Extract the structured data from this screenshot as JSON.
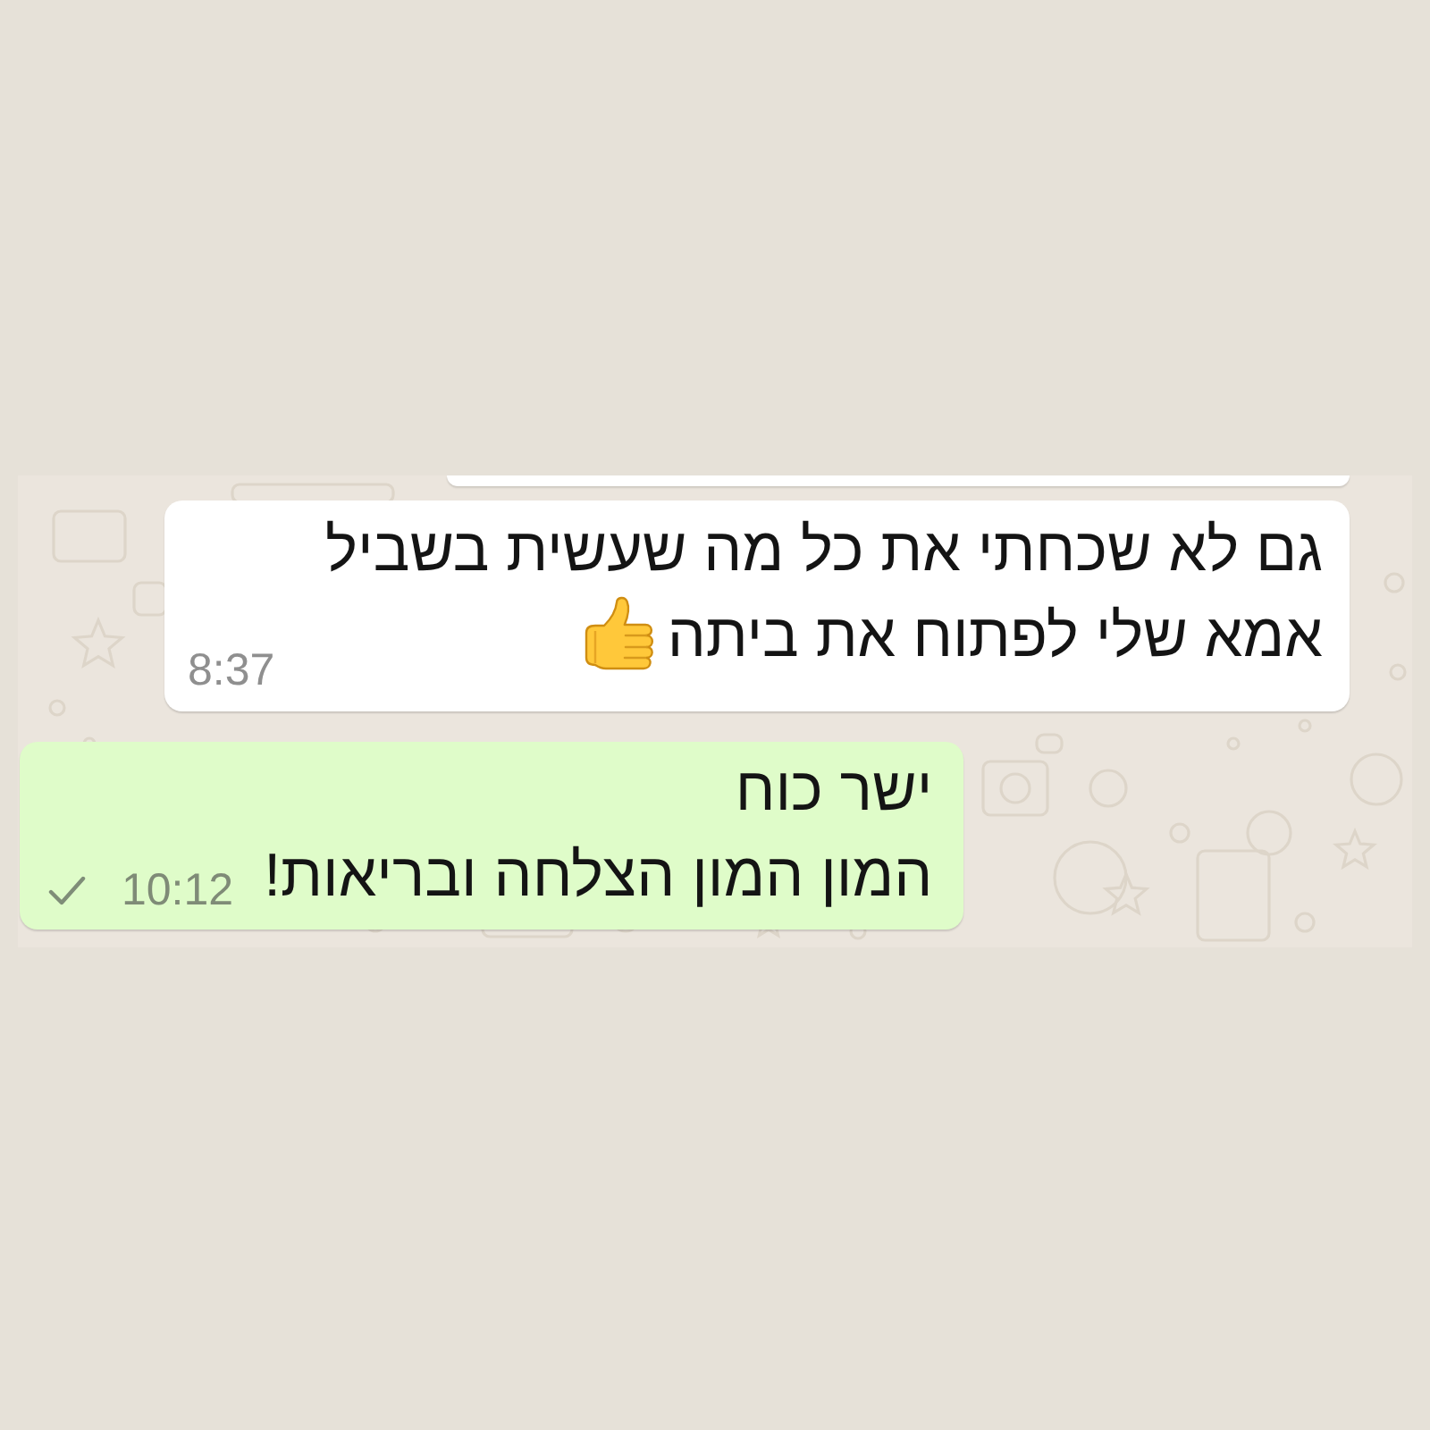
{
  "chat": {
    "messages": [
      {
        "kind": "cut_off"
      },
      {
        "kind": "incoming",
        "lines": [
          {
            "text": "גם לא שכחתי את כל מה שעשית בשביל",
            "emoji": false
          },
          {
            "text": "אמא שלי לפתוח את ביתה",
            "emoji": true
          }
        ],
        "time": "8:37"
      },
      {
        "kind": "outgoing",
        "lines": [
          {
            "text": "ישר כוח",
            "emoji": false
          },
          {
            "text": "המון המון הצלחה ובריאות!",
            "emoji": false
          }
        ],
        "time": "10:12",
        "delivered": false
      }
    ]
  }
}
